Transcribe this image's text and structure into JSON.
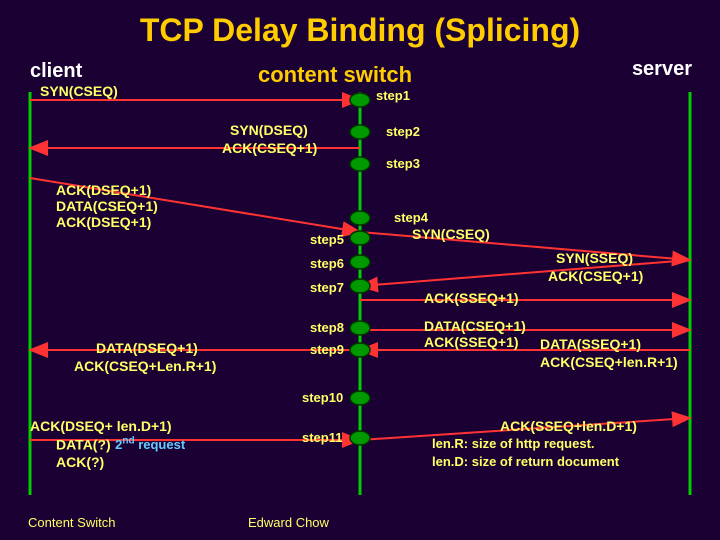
{
  "title": "TCP Delay Binding (Splicing)",
  "roles": {
    "client": "client",
    "switch": "content switch",
    "server": "server"
  },
  "client_messages": {
    "syn_cseq": "SYN(CSEQ)",
    "block1_line1": "ACK(DSEQ+1)",
    "block1_line2": "DATA(CSEQ+1)",
    "block1_line3": "ACK(DSEQ+1)",
    "block2_line1": "DATA(DSEQ+1)",
    "block2_line2": "ACK(CSEQ+Len.R+1)",
    "block3_line1": "ACK(DSEQ+  len.D+1)",
    "block3_line2a": "DATA(?)",
    "block3_line2b": "2",
    "block3_line2c": "nd",
    "block3_line2d": " request",
    "block3_line3": "ACK(?)"
  },
  "switch_messages": {
    "syn_dseq": "SYN(DSEQ)",
    "ack_cseq1": "ACK(CSEQ+1)",
    "syn_right": "SYN(CSEQ)"
  },
  "server_messages": {
    "syn_sseq": "SYN(SSEQ)",
    "ack_cseq1": "ACK(CSEQ+1)",
    "ack_sseq1": "ACK(SSEQ+1)",
    "data_cseq1": "DATA(CSEQ+1)",
    "ack_sseq1b": "ACK(SSEQ+1)",
    "data_sseq1": "DATA(SSEQ+1)",
    "ack_cseq_lenr": "ACK(CSEQ+len.R+1)",
    "ack_sseq_lend": "ACK(SSEQ+len.D+1)"
  },
  "steps": {
    "s1": "step1",
    "s2": "step2",
    "s3": "step3",
    "s4": "step4",
    "s5": "step5",
    "s6": "step6",
    "s7": "step7",
    "s8": "step8",
    "s9": "step9",
    "s10": "step10",
    "s11": "step11"
  },
  "notes": {
    "lenR": "len.R: size of http request.",
    "lenD": "len.D: size of return document"
  },
  "footer": {
    "left": "Content Switch",
    "center": "Edward Chow"
  },
  "x": {
    "client": 30,
    "switch": 360,
    "server": 690
  }
}
